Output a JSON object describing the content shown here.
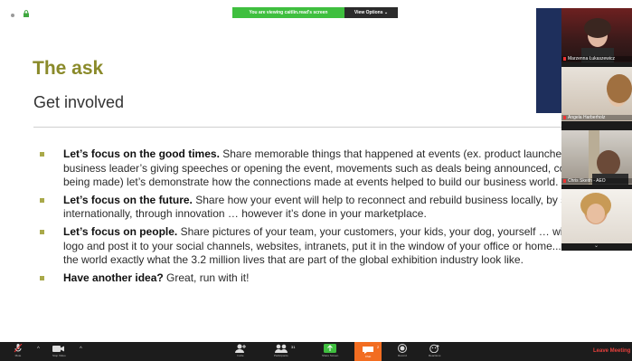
{
  "share_banner": {
    "message": "You are viewing caitlin.read's screen",
    "options": "View Options ⌄"
  },
  "slide": {
    "title": "The ask",
    "subtitle": "Get involved",
    "bullets": [
      {
        "bold": "Let’s focus on the good times.",
        "text": " Share memorable things that happened at events (ex. product launches, political or business leader’s giving speeches or opening the event, movements such as deals being announced, connections being made) let’s demonstrate how the connections made at events helped to build our business world."
      },
      {
        "bold": "Let’s focus on the future.",
        "text": " Share how your event will help to reconnect and rebuild business locally, by sector, internationally, through innovation … however it’s done in your marketplace."
      },
      {
        "bold": "Let’s focus on people.",
        "text": " Share pictures of your team, your customers, your kids, your dog, yourself … with the GED logo and post it to your social channels, websites, intranets, put it in the window of your office or home.... Let’s show the world exactly what the 3.2 million lives that are part of the global exhibition industry look like."
      },
      {
        "bold": "Have another idea?",
        "text": " Great, run with it!"
      }
    ]
  },
  "participants": [
    {
      "name": "Marzenna Łukaszewicz"
    },
    {
      "name": "Angela Harberholz"
    },
    {
      "name": "Chris Skeith - AEO"
    },
    {
      "name": ""
    }
  ],
  "toolbar": {
    "mute": "Mute",
    "video": "Stop Video",
    "invite": "Invite",
    "participants": "Participants",
    "participants_count": "31",
    "share": "Share Screen",
    "chat": "Chat",
    "chat_count": "2",
    "record": "Record",
    "reactions": "Reactions",
    "leave": "Leave Meeting"
  },
  "colors": {
    "title": "#8a8a2a",
    "bullet": "#a9a94a",
    "banner": "#3fbf3f",
    "chat": "#f26d21",
    "leave": "#e5403c"
  }
}
